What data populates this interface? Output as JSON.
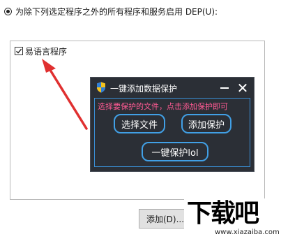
{
  "dep": {
    "radio_label": "为除下列选定程序之外的所有程序和服务启用 DEP(U):"
  },
  "program_list": {
    "items": [
      {
        "label": "易语言程序",
        "checked": true
      }
    ]
  },
  "dialog": {
    "title": "一键添加数据保护",
    "hint": "选择要保护的文件，点击添加保护即可",
    "select_file_label": "选择文件",
    "add_protect_label": "添加保护",
    "one_click_label": "一键保护lol",
    "minimize_label": "—",
    "close_label": "✕"
  },
  "footer": {
    "add_label": "添加(D)..."
  },
  "watermark": {
    "logo": "下载吧",
    "url": "www.xiazaiba.com"
  },
  "colors": {
    "dialog_bg": "#2b2f36",
    "accent_blue": "#41a0e6",
    "hint_pink": "#ff5a93",
    "arrow_red": "#e03030"
  },
  "icons": {
    "shield": "shield-icon",
    "check": "check-icon"
  }
}
